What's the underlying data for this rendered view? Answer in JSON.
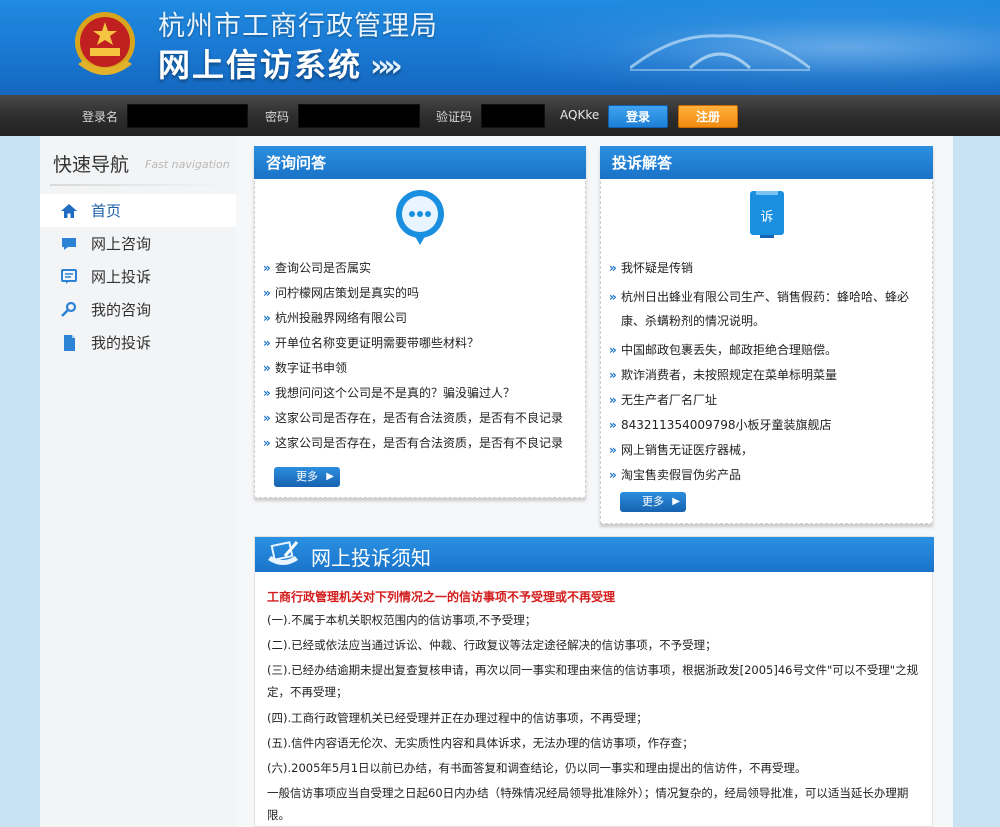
{
  "header": {
    "org_title": "杭州市工商行政管理局",
    "system_title": "网上信访系统",
    "arrows": "»»"
  },
  "login": {
    "username_label": "登录名",
    "password_label": "密码",
    "captcha_label": "验证码",
    "captcha_code": "AQKke",
    "login_button": "登录",
    "register_button": "注册"
  },
  "sidebar": {
    "title": "快速导航",
    "subtitle": "Fast navigation",
    "items": [
      {
        "label": "首页",
        "icon": "home-icon"
      },
      {
        "label": "网上咨询",
        "icon": "chat-bubble-icon"
      },
      {
        "label": "网上投诉",
        "icon": "comment-box-icon"
      },
      {
        "label": "我的咨询",
        "icon": "search-key-icon"
      },
      {
        "label": "我的投诉",
        "icon": "document-icon"
      }
    ]
  },
  "consult": {
    "title": "咨询问答",
    "items": [
      "查询公司是否属实",
      "问柠檬网店策划是真实的吗",
      "杭州投融界网络有限公司",
      "开单位名称变更证明需要带哪些材料？",
      "数字证书申领",
      "我想问问这个公司是不是真的？骗没骗过人？",
      "这家公司是否存在，是否有合法资质，是否有不良记录",
      "这家公司是否存在，是否有合法资质，是否有不良记录"
    ],
    "more": "更多"
  },
  "complaint": {
    "title": "投诉解答",
    "icon_char": "诉",
    "items": [
      "我怀疑是传销",
      "杭州日出蜂业有限公司生产、销售假药：蜂哈哈、蜂必康、杀螨粉剂的情况说明。",
      "中国邮政包裹丢失，邮政拒绝合理赔偿。",
      "欺诈消费者，未按照规定在菜单标明菜量",
      "无生产者厂名厂址",
      "843211354009798小板牙童装旗舰店",
      "网上销售无证医疗器械，",
      "淘宝售卖假冒伪劣产品"
    ],
    "more": "更多"
  },
  "notice": {
    "title": "网上投诉须知",
    "heading": "工商行政管理机关对下列情况之一的信访事项不予受理或不再受理",
    "paragraphs": [
      "(一).不属于本机关职权范围内的信访事项,不予受理；",
      "(二).已经或依法应当通过诉讼、仲裁、行政复议等法定途径解决的信访事项，不予受理；",
      "(三).已经办结逾期未提出复查复核申请，再次以同一事实和理由来信的信访事项，根据浙政发[2005]46号文件\"可以不受理\"之规定，不再受理；",
      "(四).工商行政管理机关已经受理并正在办理过程中的信访事项，不再受理；",
      "(五).信件内容语无伦次、无实质性内容和具体诉求，无法办理的信访事项，作存查；",
      "(六).2005年5月1日以前已办结，有书面答复和调查结论，仍以同一事实和理由提出的信访件，不再受理。",
      "一般信访事项应当自受理之日起60日内办结（特殊情况经局领导批准除外）；情况复杂的，经局领导批准，可以适当延长办理期限。"
    ]
  },
  "colors": {
    "header_blue": "#1a78d2",
    "panel_blue": "#1a73c8",
    "login_orange": "#f28a10",
    "notice_red": "#d41c1c"
  }
}
